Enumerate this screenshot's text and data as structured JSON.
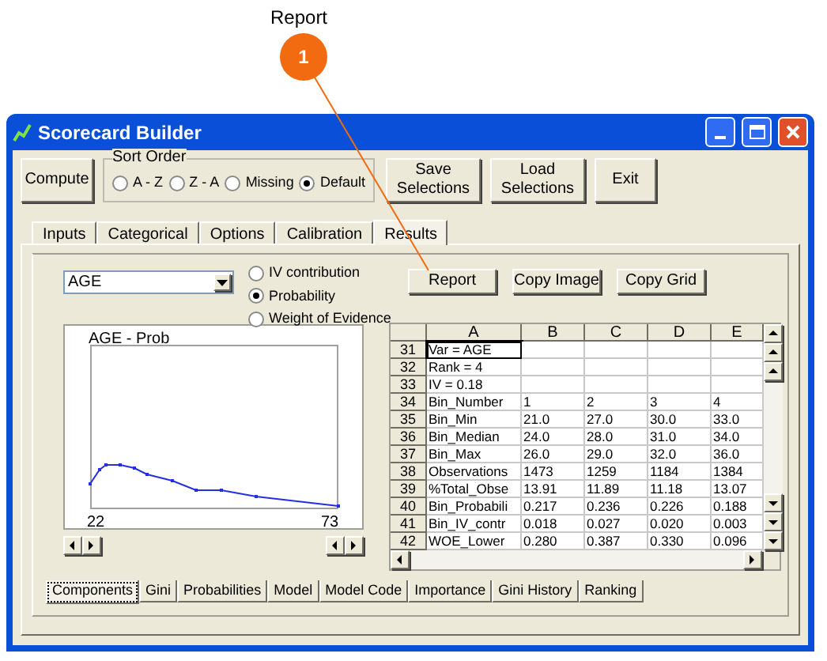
{
  "callout": {
    "label": "Report",
    "number": "1"
  },
  "window": {
    "title": "Scorecard Builder"
  },
  "toolbar": {
    "compute": "Compute",
    "sort_order": {
      "label": "Sort Order",
      "options": [
        {
          "label": "A - Z",
          "selected": false
        },
        {
          "label": "Z - A",
          "selected": false
        },
        {
          "label": "Missing",
          "selected": false
        },
        {
          "label": "Default",
          "selected": true
        }
      ]
    },
    "buttons": [
      [
        "Save",
        "Selections"
      ],
      [
        "Load",
        "Selections"
      ],
      [
        "Exit"
      ]
    ]
  },
  "tabs": [
    {
      "label": "Inputs",
      "selected": false
    },
    {
      "label": "Categorical",
      "selected": false
    },
    {
      "label": "Options",
      "selected": false
    },
    {
      "label": "Calibration",
      "selected": false
    },
    {
      "label": "Results",
      "selected": true
    }
  ],
  "results": {
    "variable": "AGE",
    "view_options": [
      {
        "label": "IV contribution",
        "selected": false
      },
      {
        "label": "Probability",
        "selected": true
      },
      {
        "label": "Weight of Evidence",
        "selected": false
      }
    ],
    "actions": [
      "Report",
      "Copy Image",
      "Copy Grid"
    ],
    "chart": {
      "title": "AGE - Prob",
      "x_labels": [
        "22",
        "73"
      ]
    },
    "grid": {
      "columns": [
        "A",
        "B",
        "C",
        "D",
        "E"
      ],
      "rows": [
        {
          "number": "31",
          "current": true,
          "cells": [
            "Var = AGE",
            "",
            "",
            "",
            ""
          ]
        },
        {
          "number": "32",
          "current": false,
          "cells": [
            "Rank = 4",
            "",
            "",
            "",
            ""
          ]
        },
        {
          "number": "33",
          "current": false,
          "cells": [
            "IV = 0.18",
            "",
            "",
            "",
            ""
          ]
        },
        {
          "number": "34",
          "current": false,
          "cells": [
            "Bin_Number",
            "1",
            "2",
            "3",
            "4"
          ]
        },
        {
          "number": "35",
          "current": false,
          "cells": [
            "Bin_Min",
            "21.0",
            "27.0",
            "30.0",
            "33.0"
          ]
        },
        {
          "number": "36",
          "current": false,
          "cells": [
            "Bin_Median",
            "24.0",
            "28.0",
            "31.0",
            "34.0"
          ]
        },
        {
          "number": "37",
          "current": false,
          "cells": [
            "Bin_Max",
            "26.0",
            "29.0",
            "32.0",
            "36.0"
          ]
        },
        {
          "number": "38",
          "current": false,
          "cells": [
            "Observations",
            "1473",
            "1259",
            "1184",
            "1384"
          ]
        },
        {
          "number": "39",
          "current": false,
          "cells": [
            "%Total_Obse",
            "13.91",
            "11.89",
            "11.18",
            "13.07"
          ]
        },
        {
          "number": "40",
          "current": false,
          "cells": [
            "Bin_Probabili",
            "0.217",
            "0.236",
            "0.226",
            "0.188"
          ]
        },
        {
          "number": "41",
          "current": false,
          "cells": [
            "Bin_IV_contr",
            "0.018",
            "0.027",
            "0.020",
            "0.003"
          ]
        },
        {
          "number": "42",
          "current": false,
          "cells": [
            "WOE_Lower",
            "0.280",
            "0.387",
            "0.330",
            "0.096"
          ]
        }
      ]
    },
    "bottom_tabs": [
      {
        "label": "Components",
        "selected": true
      },
      {
        "label": "Gini",
        "selected": false
      },
      {
        "label": "Probabilities",
        "selected": false
      },
      {
        "label": "Model",
        "selected": false
      },
      {
        "label": "Model Code",
        "selected": false
      },
      {
        "label": "Importance",
        "selected": false
      },
      {
        "label": "Gini History",
        "selected": false
      },
      {
        "label": "Ranking",
        "selected": false
      }
    ]
  }
}
